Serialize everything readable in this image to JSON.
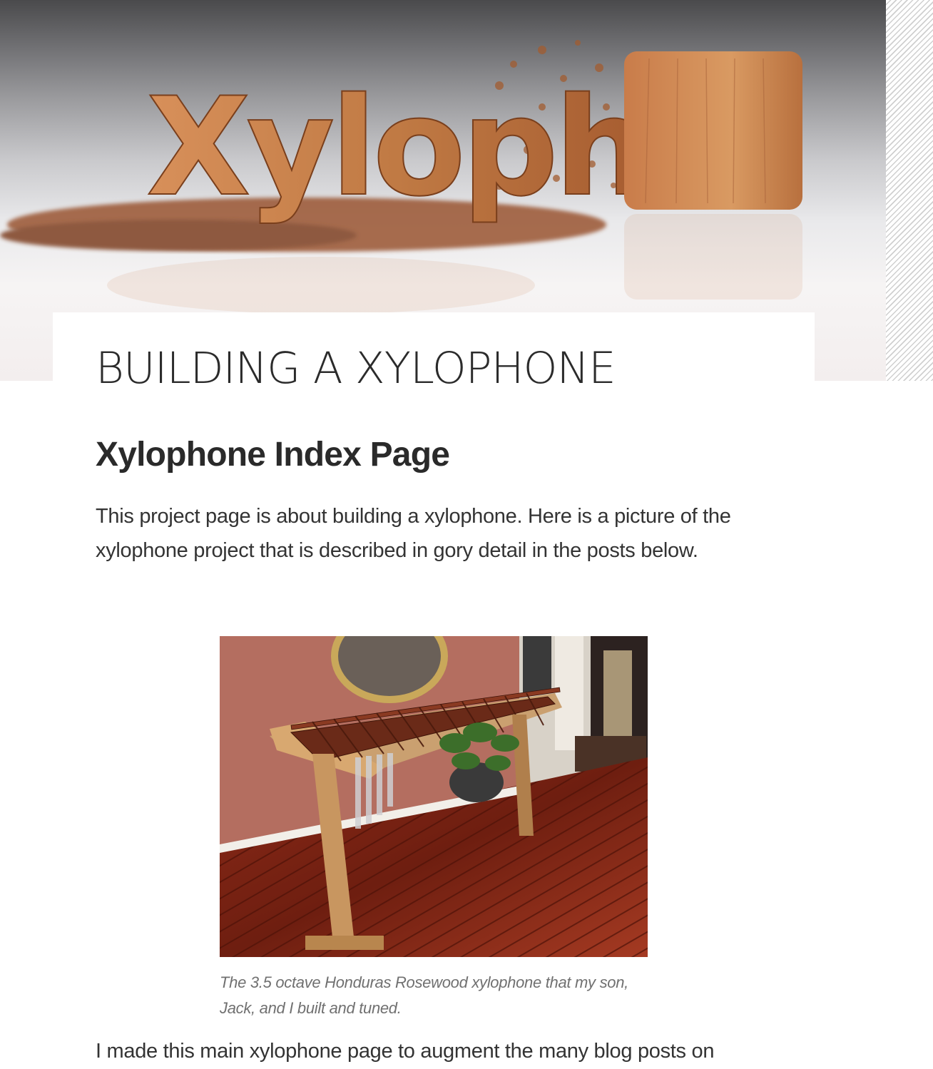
{
  "header": {
    "banner_text": "Xyloph",
    "site_title": "BUILDING A XYLOPHONE"
  },
  "article": {
    "heading": "Xylophone Index Page",
    "intro": "This project page is about building a xylophone. Here is a picture of the xylophone project that is described in gory detail in the posts below.",
    "figure": {
      "caption": "The 3.5 octave Honduras Rosewood xylophone that my son, Jack, and I built and tuned."
    },
    "closing": "I made this main xylophone page to augment the many blog posts on"
  },
  "colors": {
    "wood": "#b8713e",
    "wood_dark": "#8a4a24",
    "text": "#333333",
    "caption": "#707070",
    "wall": "#b06a5a",
    "floor": "#7a2416"
  },
  "icons": {
    "banner": "carved-wood-xylophone-logo",
    "photo": "xylophone-photo"
  }
}
